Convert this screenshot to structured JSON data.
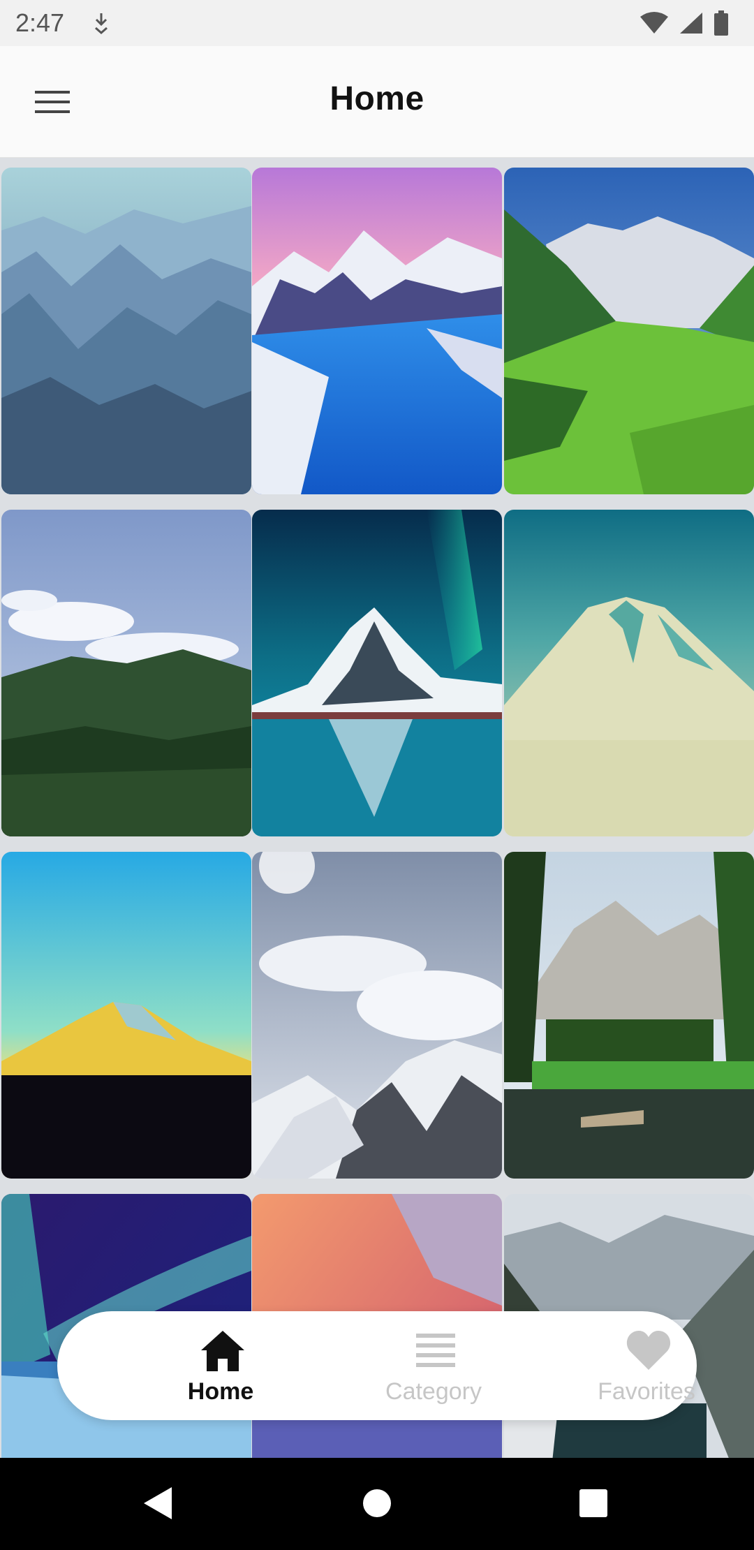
{
  "status_bar": {
    "time": "2:47",
    "icons": [
      "download-icon",
      "wifi-icon",
      "signal-icon",
      "battery-icon"
    ]
  },
  "app_bar": {
    "title": "Home",
    "menu_icon": "hamburger-menu-icon"
  },
  "wallpapers": [
    {
      "name": "blue-misty-mountains"
    },
    {
      "name": "pink-sky-fjord"
    },
    {
      "name": "green-alpine-valley"
    },
    {
      "name": "cloudy-green-hills"
    },
    {
      "name": "aurora-reflection-mountain"
    },
    {
      "name": "teal-volcano"
    },
    {
      "name": "fuji-sunrise"
    },
    {
      "name": "snowy-cloud-peaks"
    },
    {
      "name": "forest-lake-mountain"
    },
    {
      "name": "aurora-frozen-lake"
    },
    {
      "name": "pink-glow-peak"
    },
    {
      "name": "rocky-snow-valley"
    }
  ],
  "bottom_nav": {
    "items": [
      {
        "label": "Home",
        "icon": "home-icon",
        "active": true
      },
      {
        "label": "Category",
        "icon": "category-list-icon",
        "active": false
      },
      {
        "label": "Favorites",
        "icon": "heart-icon",
        "active": false
      }
    ]
  },
  "system_nav": [
    "back-icon",
    "home-circle-icon",
    "recents-square-icon"
  ],
  "colors": {
    "active_nav": "#111111",
    "inactive_nav": "#c6c6c6",
    "app_bar_bg": "#fafafa",
    "status_bar_bg": "#f1f1f1"
  }
}
